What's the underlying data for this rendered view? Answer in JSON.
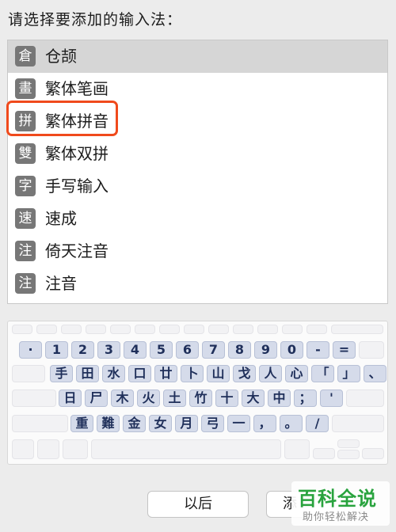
{
  "prompt": "请选择要添加的输入法：",
  "methods": [
    {
      "glyph": "倉",
      "label": "仓颉"
    },
    {
      "glyph": "畫",
      "label": "繁体笔画"
    },
    {
      "glyph": "拼",
      "label": "繁体拼音"
    },
    {
      "glyph": "雙",
      "label": "繁体双拼"
    },
    {
      "glyph": "字",
      "label": "手写输入"
    },
    {
      "glyph": "速",
      "label": "速成"
    },
    {
      "glyph": "注",
      "label": "倚天注音"
    },
    {
      "glyph": "注",
      "label": "注音"
    }
  ],
  "selected_index": 0,
  "highlighted_index": 2,
  "keyboard": {
    "row1": [
      "·",
      "1",
      "2",
      "3",
      "4",
      "5",
      "6",
      "7",
      "8",
      "9",
      "0",
      "-",
      "="
    ],
    "row2": [
      "手",
      "田",
      "水",
      "口",
      "廿",
      "卜",
      "山",
      "戈",
      "人",
      "心",
      "「",
      "」",
      "、"
    ],
    "row3": [
      "日",
      "尸",
      "木",
      "火",
      "土",
      "竹",
      "十",
      "大",
      "中",
      "；",
      "'"
    ],
    "row4": [
      "重",
      "難",
      "金",
      "女",
      "月",
      "弓",
      "一",
      "，",
      "。",
      "/"
    ]
  },
  "buttons": {
    "back": "以后",
    "add": "添"
  },
  "watermark": {
    "main": "百科全说",
    "sub": "助你轻松解决"
  },
  "colors": {
    "highlight": "#f04a1c",
    "watermark": "#29a33e"
  }
}
